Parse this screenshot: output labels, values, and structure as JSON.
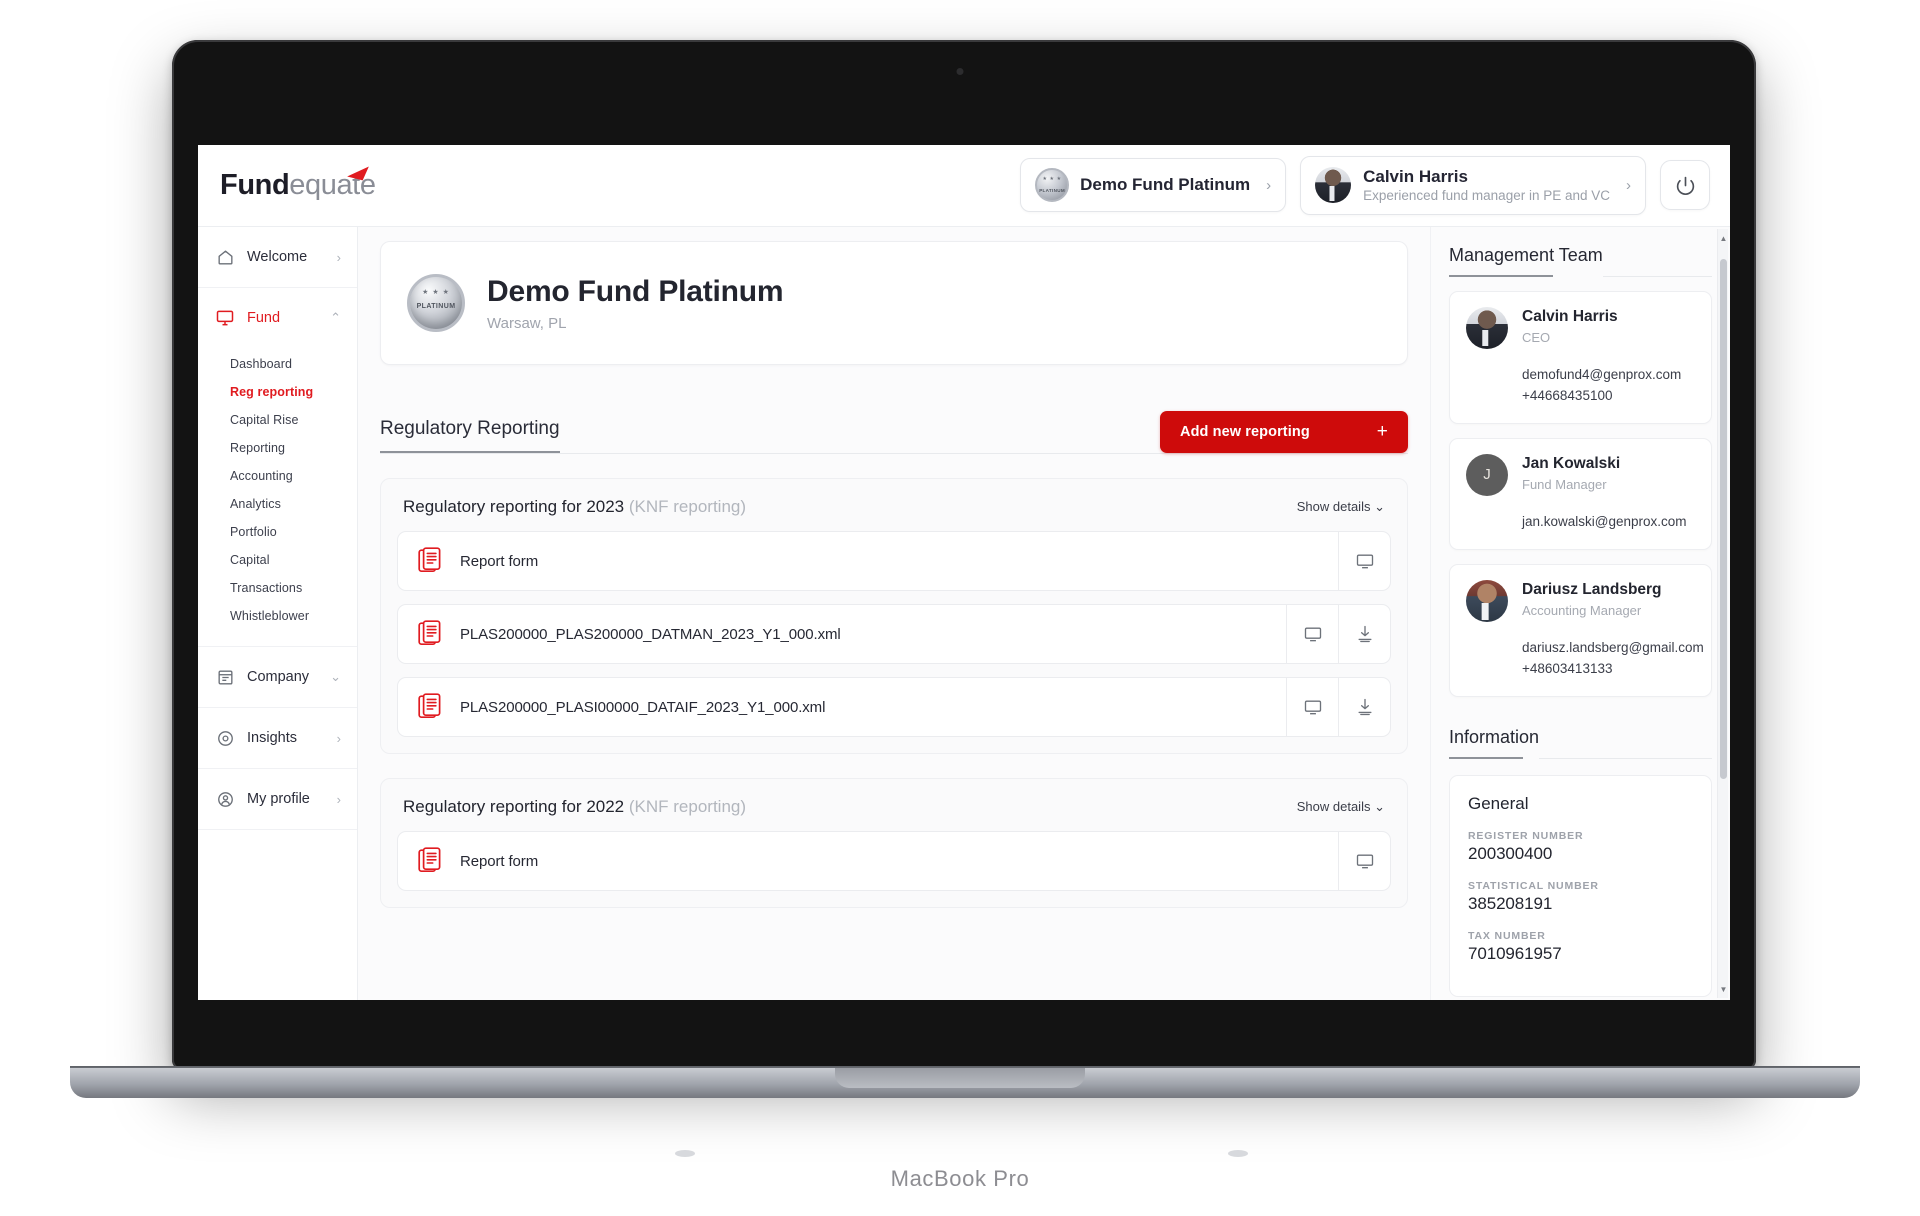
{
  "device": {
    "label": "MacBook Pro"
  },
  "topbar": {
    "logo_bold": "Fund",
    "logo_light": "equate",
    "fund_selector": {
      "name": "Demo Fund Platinum",
      "chevron": "›",
      "badge_icon": "platinum-seal-icon"
    },
    "user_menu": {
      "name": "Calvin Harris",
      "subtitle": "Experienced fund manager in PE and VC",
      "chevron": "›",
      "avatar_icon": "user-avatar-photo"
    },
    "power_icon": "power-icon"
  },
  "sidebar": {
    "groups": [
      {
        "label": "Welcome",
        "icon": "home-icon",
        "caret": "›",
        "expanded": false,
        "active": false,
        "items": []
      },
      {
        "label": "Fund",
        "icon": "monitor-icon",
        "caret": "⌃",
        "expanded": true,
        "active": true,
        "items": [
          {
            "label": "Dashboard",
            "current": false
          },
          {
            "label": "Reg reporting",
            "current": true
          },
          {
            "label": "Capital Rise",
            "current": false
          },
          {
            "label": "Reporting",
            "current": false
          },
          {
            "label": "Accounting",
            "current": false
          },
          {
            "label": "Analytics",
            "current": false
          },
          {
            "label": "Portfolio",
            "current": false
          },
          {
            "label": "Capital",
            "current": false
          },
          {
            "label": "Transactions",
            "current": false
          },
          {
            "label": "Whistleblower",
            "current": false
          }
        ]
      },
      {
        "label": "Company",
        "icon": "document-icon",
        "caret": "⌄",
        "expanded": false,
        "active": false,
        "items": []
      },
      {
        "label": "Insights",
        "icon": "compass-icon",
        "caret": "›",
        "expanded": false,
        "active": false,
        "items": []
      },
      {
        "label": "My profile",
        "icon": "person-icon",
        "caret": "›",
        "expanded": false,
        "active": false,
        "items": []
      }
    ]
  },
  "main": {
    "fund": {
      "name": "Demo Fund Platinum",
      "location": "Warsaw, PL",
      "seal_icon": "platinum-seal-icon"
    },
    "section": {
      "title": "Regulatory Reporting",
      "add_button_label": "Add new reporting",
      "add_button_plus": "+"
    },
    "reports": [
      {
        "title": "Regulatory reporting for 2023",
        "subtitle": "(KNF reporting)",
        "show_details_label": "Show details",
        "show_details_caret": "⌄",
        "rows": [
          {
            "name": "Report form",
            "file_icon": "red-document-icon",
            "actions": [
              "monitor-icon"
            ]
          },
          {
            "name": "PLAS200000_PLAS200000_DATMAN_2023_Y1_000.xml",
            "file_icon": "red-document-icon",
            "actions": [
              "monitor-icon",
              "download-icon"
            ]
          },
          {
            "name": "PLAS200000_PLASI00000_DATAIF_2023_Y1_000.xml",
            "file_icon": "red-document-icon",
            "actions": [
              "monitor-icon",
              "download-icon"
            ]
          }
        ]
      },
      {
        "title": "Regulatory reporting for 2022",
        "subtitle": "(KNF reporting)",
        "show_details_label": "Show details",
        "show_details_caret": "⌄",
        "rows": [
          {
            "name": "Report form",
            "file_icon": "red-document-icon",
            "actions": [
              "monitor-icon"
            ]
          }
        ]
      }
    ]
  },
  "rightpanel": {
    "management_team": {
      "title": "Management Team",
      "members": [
        {
          "name": "Calvin Harris",
          "role": "CEO",
          "email": "demofund4@genprox.com",
          "phone": "+44668435100",
          "avatar_type": "photo",
          "initial": ""
        },
        {
          "name": "Jan Kowalski",
          "role": "Fund Manager",
          "email": "jan.kowalski@genprox.com",
          "phone": "",
          "avatar_type": "initial",
          "initial": "J"
        },
        {
          "name": "Dariusz Landsberg",
          "role": "Accounting Manager",
          "email": "dariusz.landsberg@gmail.com",
          "phone": "+48603413133",
          "avatar_type": "photo",
          "initial": ""
        }
      ]
    },
    "information": {
      "title": "Information",
      "card_title": "General",
      "fields": [
        {
          "label": "REGISTER NUMBER",
          "value": "200300400"
        },
        {
          "label": "STATISTICAL NUMBER",
          "value": "385208191"
        },
        {
          "label": "TAX NUMBER",
          "value": "7010961957"
        }
      ]
    }
  },
  "colors": {
    "accent": "#e01b20",
    "button": "#ce0b0b",
    "text": "#23252f",
    "muted": "#a0a4ad"
  }
}
